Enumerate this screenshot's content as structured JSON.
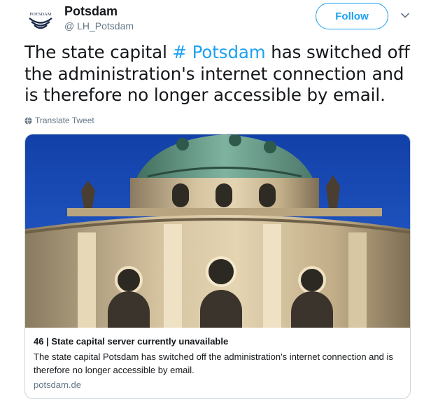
{
  "tweet": {
    "author": {
      "name": "Potsdam",
      "handle": "@ LH_Potsdam",
      "avatar_text": "POTSDAM"
    },
    "follow_label": "Follow",
    "text_before": "The state capital ",
    "hashtag": "# Potsdam",
    "text_after": " has switched off the administration's internet connection and is therefore no longer accessible by email.",
    "translate_label": "Translate Tweet",
    "icons": {
      "caret": "chevron-down-icon",
      "translate": "globe-icon"
    }
  },
  "card": {
    "title": "46 | State capital server currently unavailable",
    "description": "The state capital Potsdam has switched off the administration's internet connection and is therefore no longer accessible by email.",
    "domain": "potsdam.de",
    "image_alt": "building-dome-photo"
  },
  "colors": {
    "accent": "#1da1f2",
    "text": "#14171a",
    "muted": "#657786",
    "border": "#ccd6dd",
    "sky": "#1a4bb8"
  }
}
